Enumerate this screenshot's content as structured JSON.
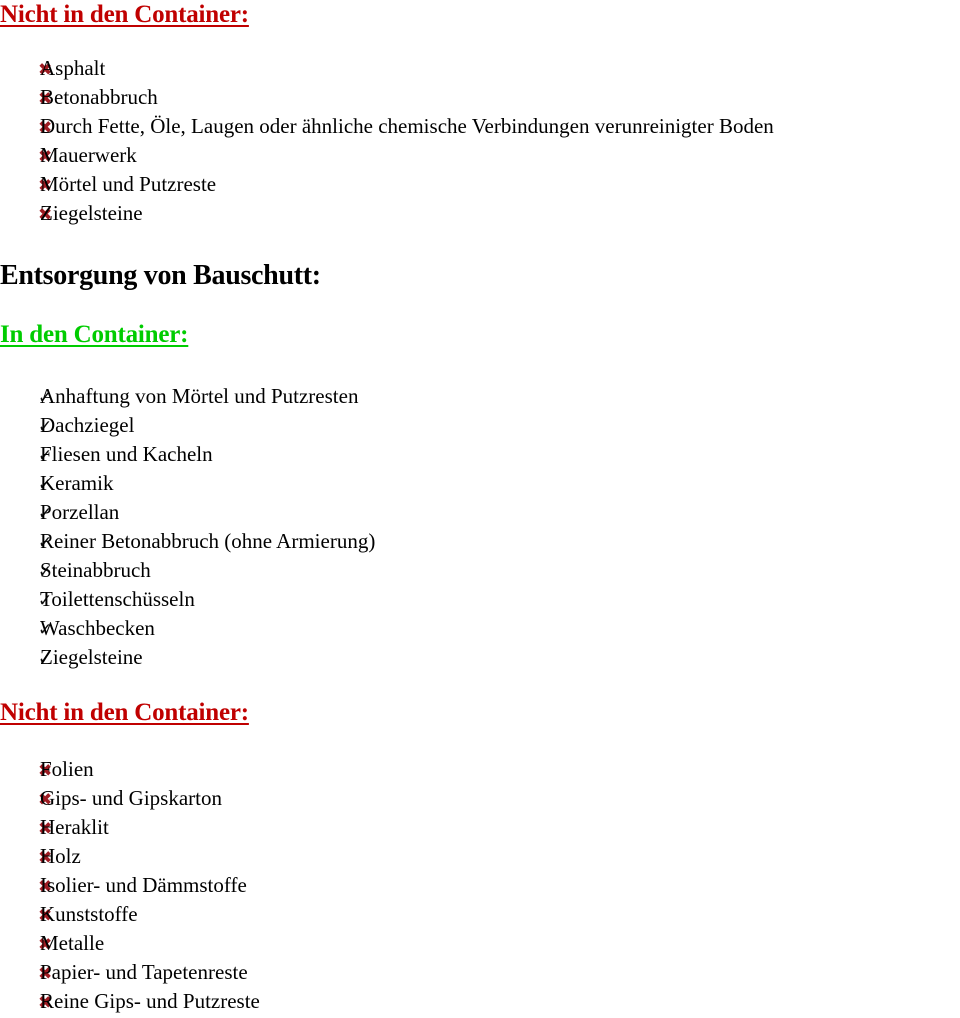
{
  "document": {
    "language": "de",
    "background_color": "#ffffff",
    "body_text_color": "#000000"
  },
  "colors": {
    "heading_red": "#C00000",
    "heading_green": "#00CC00",
    "bullet_x_red": "#9E1B22",
    "bullet_check_black": "#101010"
  },
  "sections": {
    "top_excluded": {
      "heading": "Nicht in den Container:",
      "heading_color": "#C00000",
      "bullet_icon": "cross-mark-icon",
      "bullet_glyph": "✖",
      "items": [
        "Asphalt",
        "Betonabbruch",
        "Durch Fette, Öle, Laugen oder ähnliche chemische Verbindungen verunreinigter Boden",
        "Mauerwerk",
        "Mörtel und Putzreste",
        "Ziegelsteine"
      ]
    },
    "main_heading": "Entsorgung von Bauschutt:",
    "included": {
      "heading": "In den Container:",
      "heading_color": "#00CC00",
      "bullet_icon": "check-mark-icon",
      "bullet_glyph": "✓",
      "items": [
        "Anhaftung von Mörtel und Putzresten",
        "Dachziegel",
        "Fliesen und Kacheln",
        "Keramik",
        "Porzellan",
        "Reiner Betonabbruch (ohne Armierung)",
        "Steinabbruch",
        "Toilettenschüsseln",
        "Waschbecken",
        "Ziegelsteine"
      ]
    },
    "excluded": {
      "heading": "Nicht in den Container:",
      "heading_color": "#C00000",
      "bullet_icon": "cross-mark-icon",
      "bullet_glyph": "✖",
      "items": [
        "Folien",
        "Gips- und Gipskarton",
        "Heraklit",
        "Holz",
        "Isolier- und Dämmstoffe",
        "Kunststoffe",
        "Metalle",
        "Papier- und Tapetenreste",
        "Reine Gips- und Putzreste"
      ]
    }
  }
}
